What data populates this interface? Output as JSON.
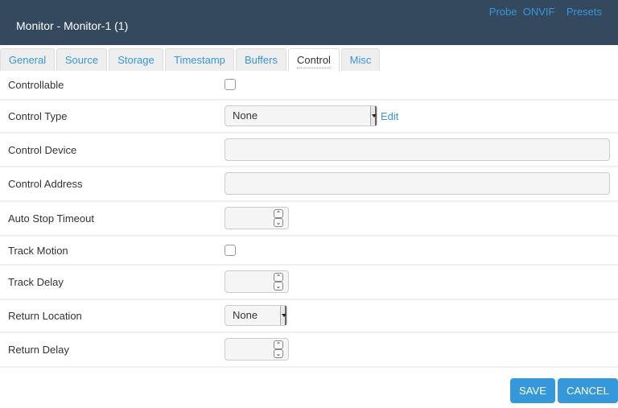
{
  "header": {
    "title": "Monitor - Monitor-1 (1)",
    "links": [
      "Probe",
      "ONVIF",
      "Presets"
    ]
  },
  "tabs": [
    {
      "label": "General",
      "active": false
    },
    {
      "label": "Source",
      "active": false
    },
    {
      "label": "Storage",
      "active": false
    },
    {
      "label": "Timestamp",
      "active": false
    },
    {
      "label": "Buffers",
      "active": false
    },
    {
      "label": "Control",
      "active": true
    },
    {
      "label": "Misc",
      "active": false
    }
  ],
  "form": {
    "controllable": {
      "label": "Controllable",
      "checked": false
    },
    "control_type": {
      "label": "Control Type",
      "value": "None",
      "edit_label": "Edit"
    },
    "control_device": {
      "label": "Control Device",
      "value": ""
    },
    "control_address": {
      "label": "Control Address",
      "value": ""
    },
    "auto_stop_timeout": {
      "label": "Auto Stop Timeout",
      "value": ""
    },
    "track_motion": {
      "label": "Track Motion",
      "checked": false
    },
    "track_delay": {
      "label": "Track Delay",
      "value": ""
    },
    "return_location": {
      "label": "Return Location",
      "value": "None"
    },
    "return_delay": {
      "label": "Return Delay",
      "value": ""
    }
  },
  "footer": {
    "save_label": "SAVE",
    "cancel_label": "CANCEL"
  },
  "icons": {
    "spin_up": "⌃",
    "spin_down": "⌄"
  }
}
